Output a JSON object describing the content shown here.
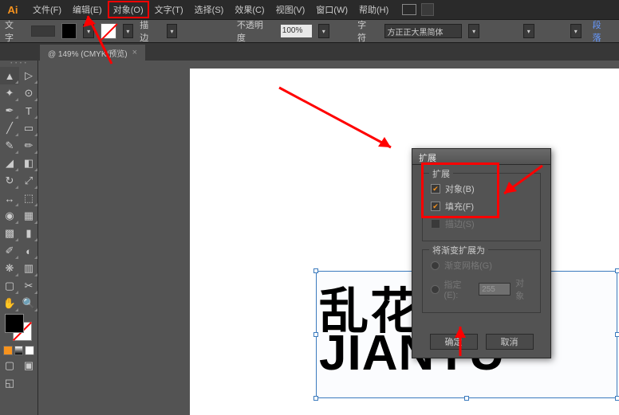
{
  "app_logo": "Ai",
  "menus": [
    "文件(F)",
    "编辑(E)",
    "对象(O)",
    "文字(T)",
    "选择(S)",
    "效果(C)",
    "视图(V)",
    "窗口(W)",
    "帮助(H)"
  ],
  "optbar": {
    "label_text": "文字",
    "stroke_label": "描边",
    "opacity_label": "不透明度",
    "opacity_value": "100%",
    "char_label": "字符",
    "font_name": "方正正大黑简体",
    "para_label": "段落"
  },
  "tab": {
    "title": "@ 149% (CMYK/预览)",
    "close": "×"
  },
  "dialog": {
    "title": "扩展",
    "group1_title": "扩展",
    "chk_object": "对象(B)",
    "chk_fill": "填充(F)",
    "chk_stroke": "描边(S)",
    "group2_title": "将渐变扩展为",
    "radio_mesh": "渐变网格(G)",
    "radio_specify": "指定(E):",
    "specify_value": "255",
    "specify_unit": "对象",
    "btn_ok": "确定",
    "btn_cancel": "取消"
  },
  "canvas_text": {
    "cn": "乱花",
    "en": "JIANYU"
  }
}
